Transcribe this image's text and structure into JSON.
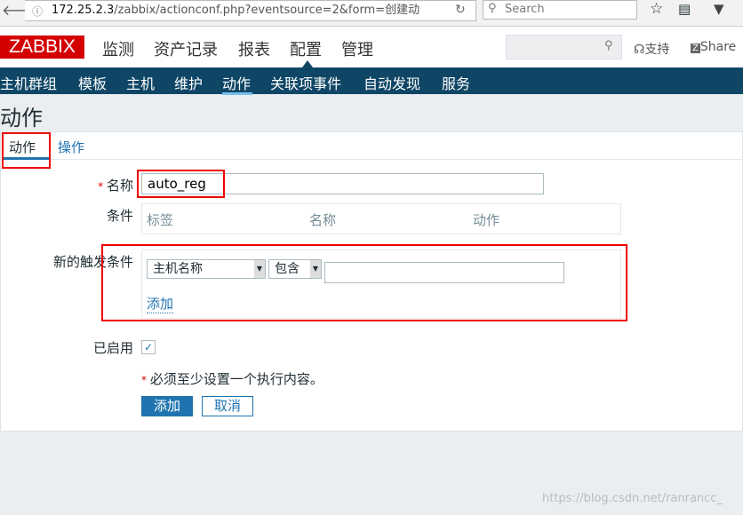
{
  "browser": {
    "url_host": "172.25.2.3",
    "url_path": "/zabbix/actionconf.php?eventsource=2&form=创建动",
    "search_placeholder": "Search"
  },
  "header": {
    "logo": "ZABBIX",
    "menu": [
      "监测",
      "资产记录",
      "报表",
      "配置",
      "管理"
    ],
    "active_menu": "配置",
    "support": "支持",
    "share": "Share"
  },
  "subnav": {
    "items": [
      "主机群组",
      "模板",
      "主机",
      "维护",
      "动作",
      "关联项事件",
      "自动发现",
      "服务"
    ],
    "active": "动作"
  },
  "page": {
    "title": "动作"
  },
  "tabs": [
    "动作",
    "操作"
  ],
  "form": {
    "name_label": "名称",
    "name_value": "auto_reg",
    "conditions_label": "条件",
    "conditions_headers": [
      "标签",
      "名称",
      "动作"
    ],
    "new_condition_label": "新的触发条件",
    "condition_type": "主机名称",
    "condition_operator": "包含",
    "condition_value": "",
    "add_link": "添加",
    "enabled_label": "已启用",
    "enabled": true,
    "note": "必须至少设置一个执行内容。",
    "add_button": "添加",
    "cancel_button": "取消"
  },
  "watermark": "https://blog.csdn.net/ranrancc_"
}
